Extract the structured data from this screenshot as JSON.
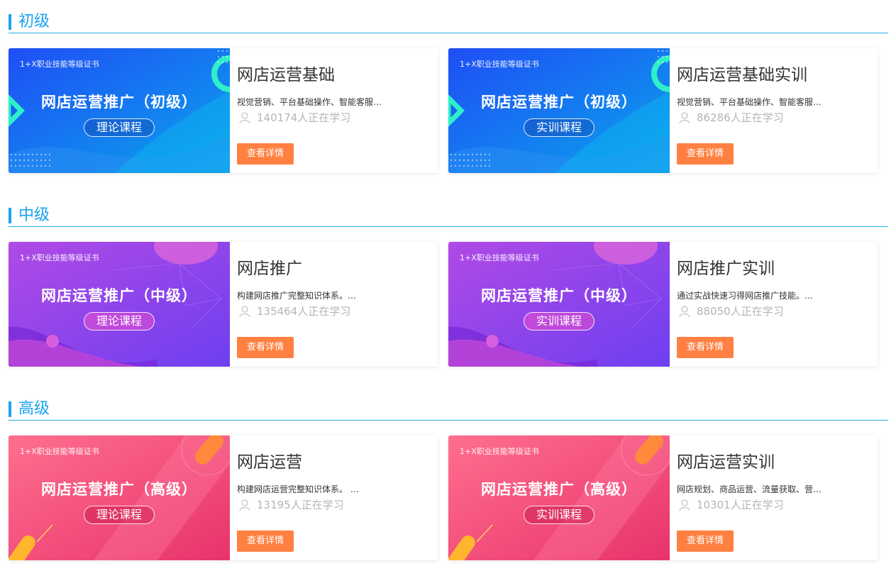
{
  "sections": [
    {
      "title": "初级",
      "theme": "blue",
      "cards": [
        {
          "thumb_cert": "1+X职业技能等级证书",
          "thumb_title": "网店运营推广（初级）",
          "thumb_tag": "理论课程",
          "name": "网店运营基础",
          "desc": "视觉营销、平台基础操作、智能客服…",
          "learners": "140174人正在学习",
          "button": "查看详情"
        },
        {
          "thumb_cert": "1+X职业技能等级证书",
          "thumb_title": "网店运营推广（初级）",
          "thumb_tag": "实训课程",
          "name": "网店运营基础实训",
          "desc": "视觉营销、平台基础操作、智能客服…",
          "learners": "86286人正在学习",
          "button": "查看详情"
        }
      ]
    },
    {
      "title": "中级",
      "theme": "purple",
      "cards": [
        {
          "thumb_cert": "1+X职业技能等级证书",
          "thumb_title": "网店运营推广（中级）",
          "thumb_tag": "理论课程",
          "name": "网店推广",
          "desc": "构建网店推广完整知识体系。…",
          "learners": "135464人正在学习",
          "button": "查看详情"
        },
        {
          "thumb_cert": "1+X职业技能等级证书",
          "thumb_title": "网店运营推广（中级）",
          "thumb_tag": "实训课程",
          "name": "网店推广实训",
          "desc": "通过实战快速习得网店推广技能。…",
          "learners": "88050人正在学习",
          "button": "查看详情"
        }
      ]
    },
    {
      "title": "高级",
      "theme": "pink",
      "cards": [
        {
          "thumb_cert": "1+X职业技能等级证书",
          "thumb_title": "网店运营推广（高级）",
          "thumb_tag": "理论课程",
          "name": "网店运营",
          "desc": "构建网店运营完整知识体系。 …",
          "learners": "13195人正在学习",
          "button": "查看详情"
        },
        {
          "thumb_cert": "1+X职业技能等级证书",
          "thumb_title": "网店运营推广（高级）",
          "thumb_tag": "实训课程",
          "name": "网店运营实训",
          "desc": "网店规划、商品运营、流量获取、营…",
          "learners": "10301人正在学习",
          "button": "查看详情"
        }
      ]
    }
  ],
  "colors": {
    "accent": "#1aa3ef",
    "button": "#ff8041",
    "muted": "#b5b5b5"
  },
  "icons": {
    "learners": "user-icon"
  }
}
